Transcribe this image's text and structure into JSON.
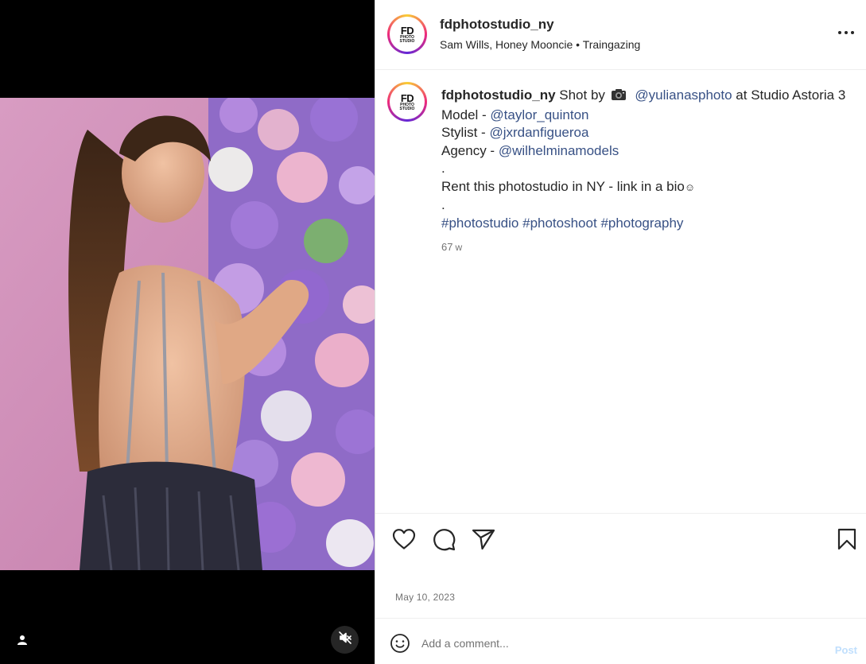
{
  "post": {
    "username": "fdphotostudio_ny",
    "location": "Sam Wills, Honey Mooncie • Traingazing",
    "avatar_logo": {
      "big": "FD",
      "line1": "PHOTO",
      "line2": "STUDIO"
    }
  },
  "caption": {
    "username": "fdphotostudio_ny",
    "shot_by": "Shot by",
    "camera_emoji": "camera-emoji",
    "photographer": "@yulianasphoto",
    "studio_text": "at Studio Astoria 3",
    "model_label": "Model - ",
    "model": "@taylor_quinton",
    "stylist_label": "Stylist - ",
    "stylist": "@jxrdanfigueroa",
    "agency_label": "Agency - ",
    "agency": "@wilhelminamodels",
    "dot1": ".",
    "rent_text": "Rent this photostudio in NY - link in a bio",
    "rent_emoji": "☺",
    "dot2": ".",
    "hashtags": [
      "#photostudio",
      "#photoshoot",
      "#photography"
    ],
    "time_ago": "67",
    "time_unit": "w"
  },
  "actions": {
    "like_icon": "heart-icon",
    "comment_icon": "comment-icon",
    "share_icon": "paper-plane-icon",
    "save_icon": "bookmark-icon"
  },
  "date": "May 10, 2023",
  "comment_box": {
    "placeholder": "Add a comment...",
    "post_label": "Post",
    "post_color": "#c0dffd"
  },
  "media": {
    "tag_icon": "user-icon",
    "mute_icon": "muted-speaker-icon"
  },
  "colors": {
    "link": "#385185",
    "secondary": "#737373",
    "text": "#262626"
  }
}
